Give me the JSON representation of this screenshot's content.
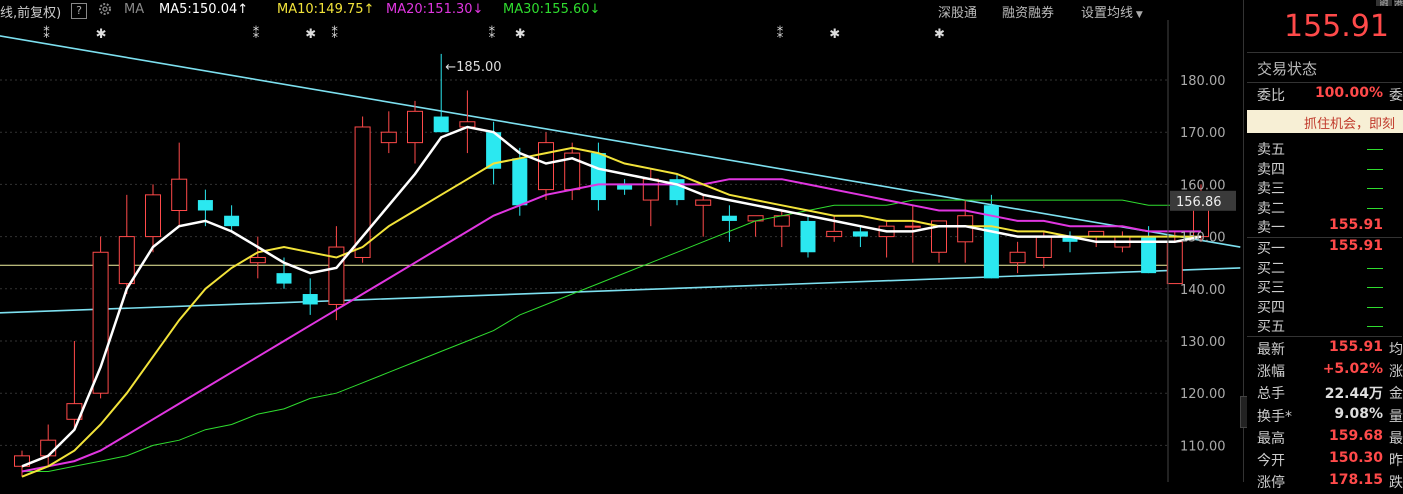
{
  "header": {
    "chart_mode": "线,前复权)",
    "help": "?",
    "settings_icon": "gear-icon",
    "ma_label": "MA",
    "ma5": {
      "label": "MA5:150.04",
      "arrow": "↑",
      "color": "#ffffff"
    },
    "ma10": {
      "label": "MA10:149.75",
      "arrow": "↑",
      "color": "#f2e33a"
    },
    "ma20": {
      "label": "MA20:151.30",
      "arrow": "↓",
      "color": "#e036e0"
    },
    "ma30": {
      "label": "MA30:155.60",
      "arrow": "↓",
      "color": "#2fdc2f"
    },
    "links": [
      "深股通",
      "融资融券",
      "设置均线"
    ],
    "dropdown_icon": "caret-down-icon"
  },
  "chart_data": {
    "type": "candlestick",
    "y_ticks": [
      "180.00",
      "170.00",
      "160.00",
      "150.00",
      "140.00",
      "130.00",
      "120.00",
      "110.00"
    ],
    "ylim": [
      105,
      190
    ],
    "current_price_label": "156.86",
    "peak_annotation": "←185.00",
    "colors": {
      "up": "#ff4a4a",
      "down": "#2be8f0",
      "ma5": "#ffffff",
      "ma10": "#f2e33a",
      "ma20": "#e036e0",
      "ma30": "#2fdc2f",
      "trendline": "#7de0f0",
      "support": "#f2f2a0"
    },
    "candles": [
      {
        "o": 106,
        "h": 109,
        "l": 104,
        "c": 108
      },
      {
        "o": 108,
        "h": 114,
        "l": 106,
        "c": 111
      },
      {
        "o": 115,
        "h": 130,
        "l": 113,
        "c": 118
      },
      {
        "o": 120,
        "h": 150,
        "l": 119,
        "c": 147
      },
      {
        "o": 141,
        "h": 158,
        "l": 139,
        "c": 150
      },
      {
        "o": 150,
        "h": 160,
        "l": 147,
        "c": 158
      },
      {
        "o": 155,
        "h": 168,
        "l": 152,
        "c": 161
      },
      {
        "o": 157,
        "h": 159,
        "l": 152,
        "c": 155
      },
      {
        "o": 154,
        "h": 156,
        "l": 151,
        "c": 152
      },
      {
        "o": 145,
        "h": 150,
        "l": 142,
        "c": 146
      },
      {
        "o": 143,
        "h": 146,
        "l": 140,
        "c": 141
      },
      {
        "o": 139,
        "h": 142,
        "l": 135,
        "c": 137
      },
      {
        "o": 137,
        "h": 152,
        "l": 134,
        "c": 148
      },
      {
        "o": 146,
        "h": 173,
        "l": 145,
        "c": 171
      },
      {
        "o": 168,
        "h": 174,
        "l": 166,
        "c": 170
      },
      {
        "o": 168,
        "h": 176,
        "l": 164,
        "c": 174
      },
      {
        "o": 173,
        "h": 185,
        "l": 170,
        "c": 170
      },
      {
        "o": 171,
        "h": 178,
        "l": 166,
        "c": 172
      },
      {
        "o": 170,
        "h": 172,
        "l": 160,
        "c": 163
      },
      {
        "o": 165,
        "h": 167,
        "l": 154,
        "c": 156
      },
      {
        "o": 159,
        "h": 170,
        "l": 157,
        "c": 168
      },
      {
        "o": 159,
        "h": 168,
        "l": 157,
        "c": 166
      },
      {
        "o": 166,
        "h": 168,
        "l": 155,
        "c": 157
      },
      {
        "o": 160,
        "h": 161,
        "l": 158,
        "c": 159
      },
      {
        "o": 157,
        "h": 163,
        "l": 152,
        "c": 161
      },
      {
        "o": 161,
        "h": 162,
        "l": 156,
        "c": 157
      },
      {
        "o": 156,
        "h": 158,
        "l": 150,
        "c": 157
      },
      {
        "o": 154,
        "h": 156,
        "l": 149,
        "c": 153
      },
      {
        "o": 153,
        "h": 154,
        "l": 150,
        "c": 154
      },
      {
        "o": 152,
        "h": 155,
        "l": 148,
        "c": 154
      },
      {
        "o": 153,
        "h": 154,
        "l": 146,
        "c": 147
      },
      {
        "o": 150,
        "h": 154,
        "l": 149,
        "c": 151
      },
      {
        "o": 151,
        "h": 152,
        "l": 148,
        "c": 150
      },
      {
        "o": 150,
        "h": 153,
        "l": 146,
        "c": 152
      },
      {
        "o": 152,
        "h": 156,
        "l": 145,
        "c": 152
      },
      {
        "o": 147,
        "h": 152,
        "l": 145,
        "c": 153
      },
      {
        "o": 149,
        "h": 157,
        "l": 145,
        "c": 154
      },
      {
        "o": 156,
        "h": 158,
        "l": 142,
        "c": 142
      },
      {
        "o": 145,
        "h": 149,
        "l": 143,
        "c": 147
      },
      {
        "o": 146,
        "h": 151,
        "l": 144,
        "c": 150
      },
      {
        "o": 150,
        "h": 151,
        "l": 147,
        "c": 149
      },
      {
        "o": 150,
        "h": 151,
        "l": 148,
        "c": 151
      },
      {
        "o": 148,
        "h": 151,
        "l": 147,
        "c": 150
      },
      {
        "o": 150,
        "h": 152,
        "l": 143,
        "c": 143
      },
      {
        "o": 141,
        "h": 151,
        "l": 141,
        "c": 149
      },
      {
        "o": 150,
        "h": 160,
        "l": 149,
        "c": 156
      }
    ],
    "ma5_values": [
      106,
      108,
      113,
      125,
      140,
      148,
      152,
      153,
      151,
      148,
      145,
      143,
      144,
      150,
      156,
      162,
      169,
      171,
      170,
      166,
      164,
      165,
      163,
      162,
      161,
      160,
      158,
      157,
      156,
      155,
      154,
      153,
      152,
      151,
      151,
      152,
      152,
      151,
      150,
      150,
      150,
      149,
      149,
      149,
      149,
      150
    ],
    "ma10_values": [
      104,
      106,
      109,
      114,
      120,
      127,
      134,
      140,
      144,
      147,
      148,
      147,
      146,
      148,
      152,
      155,
      158,
      161,
      164,
      165,
      166,
      167,
      166,
      164,
      163,
      162,
      160,
      158,
      157,
      156,
      155,
      154,
      154,
      153,
      153,
      152,
      152,
      152,
      151,
      151,
      150,
      150,
      150,
      150,
      150,
      150
    ],
    "ma20_values": [
      105,
      106,
      107,
      109,
      112,
      115,
      118,
      121,
      124,
      127,
      130,
      133,
      136,
      139,
      142,
      145,
      148,
      151,
      154,
      156,
      158,
      159,
      160,
      160,
      160,
      160,
      160,
      161,
      161,
      161,
      160,
      159,
      158,
      157,
      156,
      155,
      155,
      154,
      153,
      153,
      152,
      152,
      152,
      151,
      151,
      151
    ],
    "ma30_values": [
      105,
      105,
      106,
      107,
      108,
      110,
      111,
      113,
      114,
      116,
      117,
      119,
      120,
      122,
      124,
      126,
      128,
      130,
      132,
      135,
      137,
      139,
      141,
      143,
      145,
      147,
      149,
      151,
      153,
      154,
      155,
      156,
      156,
      156,
      157,
      157,
      157,
      157,
      157,
      157,
      157,
      157,
      157,
      156,
      156,
      156
    ],
    "trendlines": [
      {
        "x1": -1.5,
        "y1": 189,
        "x2": 46.5,
        "y2": 148
      },
      {
        "x1": -3,
        "y1": 135,
        "x2": 46.5,
        "y2": 144
      }
    ],
    "support_level": 144.5,
    "event_markers": [
      {
        "i": 1,
        "symbol": "⁑"
      },
      {
        "i": 3,
        "symbol": "✱"
      },
      {
        "i": 9,
        "symbol": "⁑"
      },
      {
        "i": 11,
        "symbol": "✱"
      },
      {
        "i": 12,
        "symbol": "⁑"
      },
      {
        "i": 18,
        "symbol": "⁑"
      },
      {
        "i": 19,
        "symbol": "✱"
      },
      {
        "i": 29,
        "symbol": "⁑"
      },
      {
        "i": 31,
        "symbol": "✱"
      },
      {
        "i": 35,
        "symbol": "✱"
      }
    ]
  },
  "sidebar": {
    "top_icons": [
      "融",
      "港"
    ],
    "price": "155.91",
    "trade_status_label": "交易状态",
    "commission_ratio": {
      "label": "委比",
      "value": "100.00%",
      "cut": "委"
    },
    "banner": "抓住机会，即刻",
    "asks": [
      {
        "label": "卖五",
        "price": ""
      },
      {
        "label": "卖四",
        "price": ""
      },
      {
        "label": "卖三",
        "price": ""
      },
      {
        "label": "卖二",
        "price": ""
      },
      {
        "label": "卖一",
        "price": "155.91"
      }
    ],
    "bids": [
      {
        "label": "买一",
        "price": "155.91"
      },
      {
        "label": "买二",
        "price": ""
      },
      {
        "label": "买三",
        "price": ""
      },
      {
        "label": "买四",
        "price": ""
      },
      {
        "label": "买五",
        "price": ""
      }
    ],
    "stats": [
      {
        "label": "最新",
        "value": "155.91",
        "cut": "均",
        "color": "#ff4a4a"
      },
      {
        "label": "涨幅",
        "value": "+5.02%",
        "cut": "涨",
        "color": "#ff4a4a"
      },
      {
        "label": "总手",
        "value": "22.44万",
        "cut": "金",
        "color": "#dddddd"
      },
      {
        "label": "换手*",
        "value": "9.08%",
        "cut": "量",
        "color": "#dddddd"
      },
      {
        "label": "最高",
        "value": "159.68",
        "cut": "最",
        "color": "#ff4a4a"
      },
      {
        "label": "今开",
        "value": "150.30",
        "cut": "昨",
        "color": "#ff4a4a"
      },
      {
        "label": "涨停",
        "value": "178.15",
        "cut": "跌",
        "color": "#ff4a4a"
      }
    ]
  }
}
